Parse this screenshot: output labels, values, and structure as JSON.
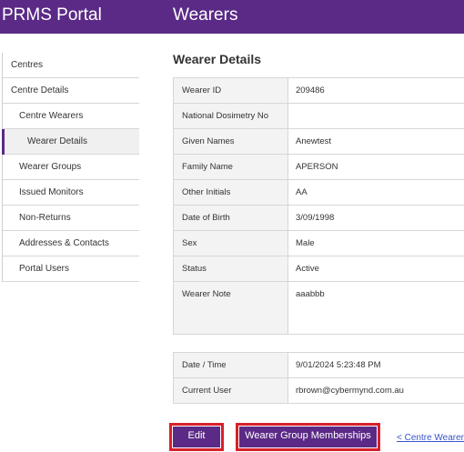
{
  "app": {
    "brand": "PRMS Portal",
    "page_heading": "Wearers"
  },
  "sidebar": {
    "items": [
      {
        "label": "Centres"
      },
      {
        "label": "Centre Details"
      },
      {
        "label": "Centre Wearers"
      },
      {
        "label": "Wearer Details"
      },
      {
        "label": "Wearer Groups"
      },
      {
        "label": "Issued Monitors"
      },
      {
        "label": "Non-Returns"
      },
      {
        "label": "Addresses & Contacts"
      },
      {
        "label": "Portal Users"
      }
    ]
  },
  "main": {
    "title": "Wearer Details",
    "details": [
      {
        "label": "Wearer ID",
        "value": "209486"
      },
      {
        "label": "National Dosimetry No",
        "value": ""
      },
      {
        "label": "Given Names",
        "value": "Anewtest"
      },
      {
        "label": "Family Name",
        "value": "APERSON"
      },
      {
        "label": "Other Initials",
        "value": "AA"
      },
      {
        "label": "Date of Birth",
        "value": "3/09/1998"
      },
      {
        "label": "Sex",
        "value": "Male"
      },
      {
        "label": "Status",
        "value": "Active"
      },
      {
        "label": "Wearer Note",
        "value": "aaabbb"
      }
    ],
    "meta": [
      {
        "label": "Date / Time",
        "value": "9/01/2024 5:23:48 PM"
      },
      {
        "label": "Current User",
        "value": "rbrown@cybermynd.com.au"
      }
    ],
    "actions": {
      "edit_label": "Edit",
      "groups_label": "Wearer Group Memberships",
      "back_label": "< Centre Wearers"
    }
  },
  "colors": {
    "brand": "#5b2a86",
    "highlight_border": "#d8202a",
    "link": "#3a55c9"
  }
}
